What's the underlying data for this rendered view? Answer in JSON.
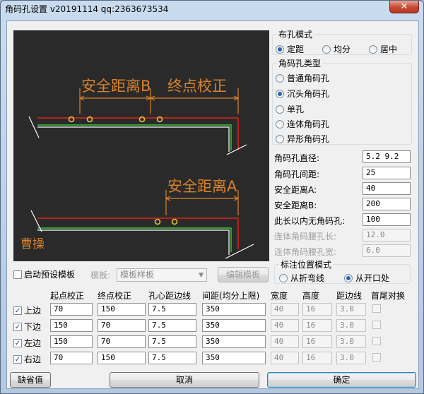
{
  "window": {
    "title": "角码孔设置 v20191114     qq:2363673534",
    "close_glyph": "✕"
  },
  "preview": {
    "label_safe_b": "安全距离B",
    "label_end_correction": "终点校正",
    "label_safe_a": "安全距离A",
    "label_corner": "曹操"
  },
  "layout_mode": {
    "title": "布孔模式",
    "options": [
      {
        "label": "定距",
        "checked": true
      },
      {
        "label": "均分",
        "checked": false
      },
      {
        "label": "居中",
        "checked": false
      }
    ]
  },
  "hole_type": {
    "title": "角码孔类型",
    "options": [
      {
        "label": "普通角码孔",
        "checked": false
      },
      {
        "label": "沉头角码孔",
        "checked": true
      },
      {
        "label": "单孔",
        "checked": false
      },
      {
        "label": "连体角码孔",
        "checked": false
      },
      {
        "label": "异形角码孔",
        "checked": false
      }
    ]
  },
  "params": {
    "diameter_label": "角码孔直径:",
    "diameter_value": "5.2 9.2",
    "spacing_label": "角码孔间距:",
    "spacing_value": "25",
    "safe_a_label": "安全距离A:",
    "safe_a_value": "40",
    "safe_b_label": "安全距离B:",
    "safe_b_value": "200",
    "no_hole_label": "此长以内无角码孔:",
    "no_hole_value": "100",
    "slot_len_label": "连体角码腰孔长:",
    "slot_len_value": "12.0",
    "slot_width_label": "连体角码腰孔宽:",
    "slot_width_value": "6.0"
  },
  "mark_mode": {
    "title": "标注位置模式",
    "options": [
      {
        "label": "从折弯线",
        "checked": false
      },
      {
        "label": "从开口处",
        "checked": true
      }
    ]
  },
  "template": {
    "enable_label": "启动预设模板",
    "enable_checked": false,
    "template_label": "模板:",
    "template_value": "模板样板",
    "edit_button": "编辑模板"
  },
  "table": {
    "headers": [
      "起点校正",
      "终点校正",
      "孔心距边线",
      "间距(均分上限)",
      "宽度",
      "高度",
      "距边线",
      "首尾对换"
    ],
    "rows": [
      {
        "name": "上边",
        "checked": true,
        "start": "70",
        "end": "150",
        "edge": "7.5",
        "spacing": "350",
        "width": "40",
        "height": "16",
        "edge2": "3.0"
      },
      {
        "name": "下边",
        "checked": true,
        "start": "150",
        "end": "70",
        "edge": "7.5",
        "spacing": "350",
        "width": "40",
        "height": "16",
        "edge2": "3.0"
      },
      {
        "name": "左边",
        "checked": true,
        "start": "150",
        "end": "70",
        "edge": "7.5",
        "spacing": "350",
        "width": "40",
        "height": "16",
        "edge2": "3.0"
      },
      {
        "name": "右边",
        "checked": true,
        "start": "70",
        "end": "150",
        "edge": "7.5",
        "spacing": "350",
        "width": "40",
        "height": "16",
        "edge2": "3.0"
      }
    ]
  },
  "buttons": {
    "defaults": "缺省值",
    "cancel": "取消",
    "ok": "确定"
  },
  "colors": {
    "canvas_bg": "#2a2a2a",
    "dim_orange": "#d9822b",
    "profile_red": "#e0211b",
    "profile_green": "#36c43a",
    "hole_yellow": "#e6c23a"
  }
}
